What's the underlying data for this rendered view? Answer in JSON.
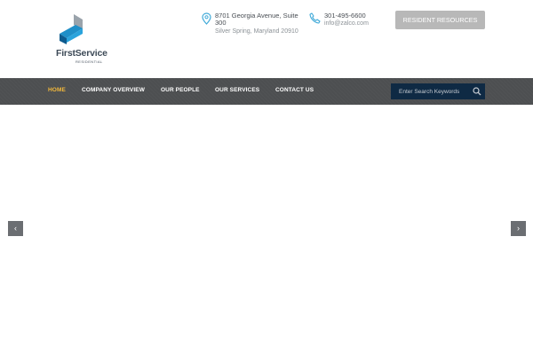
{
  "header": {
    "logo": {
      "name": "FirstService",
      "subtitle": "RESIDENTIAL",
      "colors": [
        "#1f8fc8",
        "#0d5b8f",
        "#9aa3ab"
      ]
    },
    "address": {
      "icon": "map-pin-icon",
      "line1": "8701 Georgia Avenue, Suite 300",
      "line2": "Silver Spring, Maryland 20910"
    },
    "phone": {
      "icon": "phone-icon",
      "line1": "301-495-6600",
      "line2": "info@zalco.com"
    },
    "resident_button": "Resident Resources",
    "accent_color": "#3fa9d8"
  },
  "nav": {
    "items": [
      {
        "label": "Home",
        "active": true
      },
      {
        "label": "Company Overview",
        "active": false
      },
      {
        "label": "Our People",
        "active": false
      },
      {
        "label": "Our Services",
        "active": false
      },
      {
        "label": "Contact Us",
        "active": false
      }
    ],
    "search_placeholder": "Enter Search Keywords",
    "search_icon": "search-icon",
    "active_color": "#f3b93b",
    "background": "#4d4f51"
  },
  "slider": {
    "prev_icon": "chevron-left-icon",
    "next_icon": "chevron-right-icon",
    "prev_glyph": "‹",
    "next_glyph": "›"
  }
}
